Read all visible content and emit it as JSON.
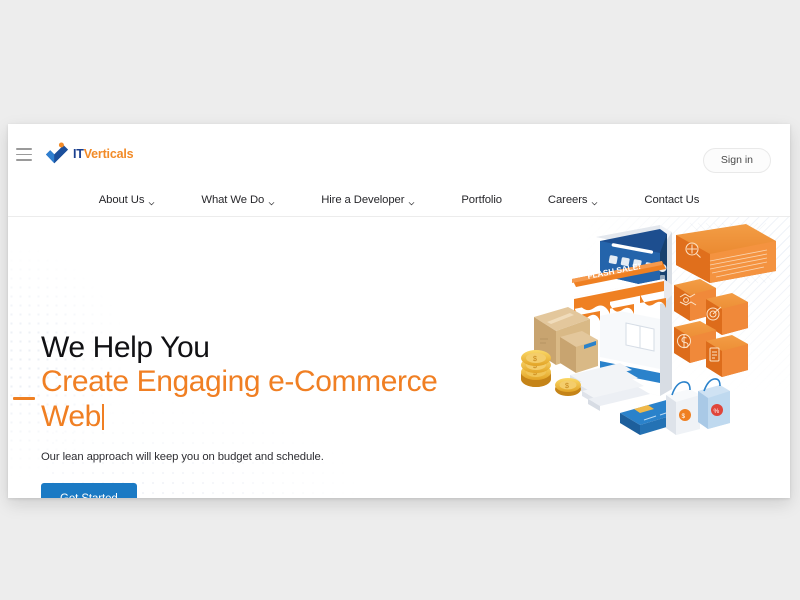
{
  "window": {
    "outer_background": "#ededed",
    "page_background": "#ffffff"
  },
  "topbar": {
    "menu_icon": "hamburger-icon",
    "logo": {
      "icon": "checkmark-swoosh-icon",
      "text_primary": "IT",
      "text_secondary": "Verticals",
      "color_primary": "#1a3f8f",
      "color_secondary": "#f28b28"
    },
    "signin_label": "Sign in"
  },
  "nav": {
    "items": [
      {
        "label": "About Us",
        "has_dropdown": true
      },
      {
        "label": "What We Do",
        "has_dropdown": true
      },
      {
        "label": "Hire a Developer",
        "has_dropdown": true
      },
      {
        "label": "Portfolio",
        "has_dropdown": false
      },
      {
        "label": "Careers",
        "has_dropdown": true
      },
      {
        "label": "Contact Us",
        "has_dropdown": false
      }
    ]
  },
  "hero": {
    "accent_dash_color": "#ef8022",
    "headline_line1": "We Help You",
    "headline_line2": "Create Engaging e-Commerce",
    "headline_line3": "Web",
    "headline_color_line1": "#111114",
    "headline_color_rest": "#f07f23",
    "typing_cursor": true,
    "subtitle": "Our lean approach will keep you on budget and schedule.",
    "cta_label": "Get Started",
    "cta_color": "#1b7ac4",
    "illustration": {
      "name": "isometric-ecommerce-illustration",
      "banner_text": "FLASH SALE!",
      "elements": [
        "smartphone-storefront",
        "striped-awning",
        "cardboard-boxes",
        "gold-coins",
        "credit-card",
        "shopping-bags",
        "stairs",
        "search-card",
        "handshake-card",
        "target-card",
        "dollar-card",
        "checklist-card"
      ],
      "accent_orange": "#ef8022",
      "accent_blue": "#1e6bb8"
    }
  }
}
